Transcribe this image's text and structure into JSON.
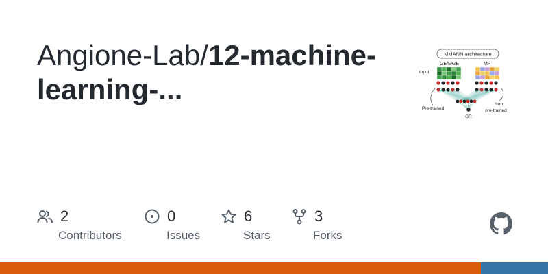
{
  "repo": {
    "owner_prefix": "Angione-Lab/",
    "name_display": "12-machine-learning-..."
  },
  "thumbnail": {
    "title": "MMANN architecture",
    "group_left": "GE/MGE",
    "group_right": "MF",
    "input_label": "Input",
    "pretrained_label": "Pre-trained",
    "non_label": "Non",
    "non_pretrained_label": "pre-trained",
    "output_label": "GR"
  },
  "stats": [
    {
      "icon": "contributors-icon",
      "count": "2",
      "label": "Contributors"
    },
    {
      "icon": "issues-icon",
      "count": "0",
      "label": "Issues"
    },
    {
      "icon": "star-icon",
      "count": "6",
      "label": "Stars"
    },
    {
      "icon": "fork-icon",
      "count": "3",
      "label": "Forks"
    }
  ],
  "language_bar": [
    {
      "color": "#DA5B0B",
      "fraction": 0.877
    },
    {
      "color": "#3572A5",
      "fraction": 0.123
    }
  ]
}
